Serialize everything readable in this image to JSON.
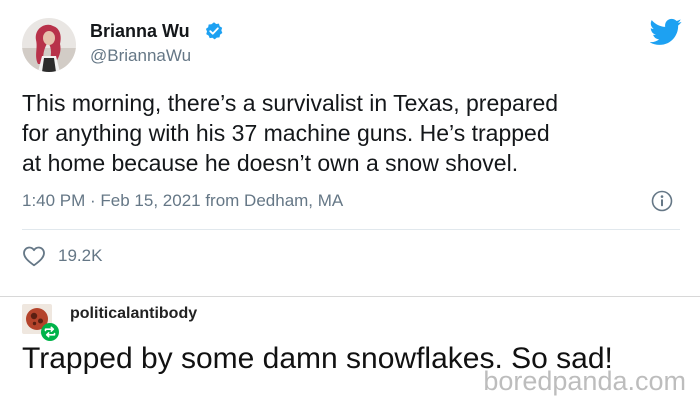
{
  "tweet": {
    "display_name": "Brianna Wu",
    "handle": "@BriannaWu",
    "text_lines": [
      "This morning, there’s a survivalist in Texas, prepared",
      "for anything with his 37 machine guns. He’s trapped",
      "at home because he doesn’t own a snow shovel."
    ],
    "timestamp": "1:40 PM · Feb 15, 2021 from Dedham, MA",
    "likes": "19.2K",
    "icons": {
      "verified": "verified-badge-icon",
      "logo": "twitter-bird-icon",
      "info": "info-icon",
      "like": "heart-icon"
    },
    "colors": {
      "twitter_blue": "#1DA1F2",
      "secondary_text": "#657786",
      "primary_text": "#14171A"
    }
  },
  "reblog": {
    "username": "politicalantibody",
    "text": "Trapped by some damn snowflakes. So sad!",
    "icons": {
      "avatar": "avatar-icon",
      "reblog": "reblog-icon"
    }
  },
  "watermark": {
    "text": "boredpanda.com"
  }
}
